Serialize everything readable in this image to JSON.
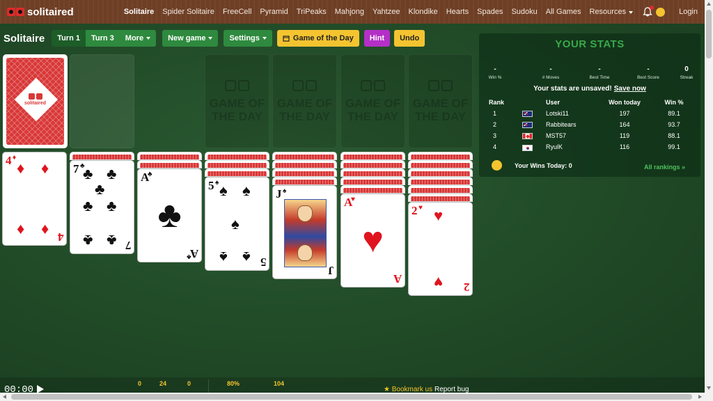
{
  "nav": {
    "logo": "solitaired",
    "links": [
      "Solitaire",
      "Spider Solitaire",
      "FreeCell",
      "Pyramid",
      "TriPeaks",
      "Mahjong",
      "Yahtzee",
      "Klondike",
      "Hearts",
      "Spades",
      "Sudoku",
      "All Games",
      "Resources"
    ],
    "active": "Solitaire",
    "login": "Login"
  },
  "toolbar": {
    "title": "Solitaire",
    "turn1": "Turn 1",
    "turn3": "Turn 3",
    "more": "More",
    "new_game": "New game",
    "settings": "Settings",
    "gotd": "Game of the Day",
    "hint": "Hint",
    "undo": "Undo"
  },
  "foundation_text": "Game of the day",
  "tableau": [
    {
      "rank": "4",
      "suit": "♦",
      "color": "red",
      "hidden": 0
    },
    {
      "rank": "7",
      "suit": "♣",
      "color": "black",
      "hidden": 1
    },
    {
      "rank": "A",
      "suit": "♣",
      "color": "black",
      "hidden": 2
    },
    {
      "rank": "5",
      "suit": "♠",
      "color": "black",
      "hidden": 3
    },
    {
      "rank": "J",
      "suit": "♠",
      "color": "black",
      "hidden": 4
    },
    {
      "rank": "A",
      "suit": "♥",
      "color": "red",
      "hidden": 5
    },
    {
      "rank": "2",
      "suit": "♥",
      "color": "red",
      "hidden": 6
    }
  ],
  "stats": {
    "title": "YOUR STATS",
    "items": [
      {
        "value": "-",
        "label": "Win %"
      },
      {
        "value": "-",
        "label": "# Moves"
      },
      {
        "value": "-",
        "label": "Best Time"
      },
      {
        "value": "-",
        "label": "Best Score"
      },
      {
        "value": "0",
        "label": "Streak"
      }
    ],
    "unsaved": "Your stats are unsaved!",
    "save_now": "Save now",
    "headers": [
      "Rank",
      "User",
      "Won today",
      "Win %"
    ],
    "rows": [
      {
        "rank": "1",
        "flag": "au",
        "user": "Lotski11",
        "won": "197",
        "win": "89.1"
      },
      {
        "rank": "2",
        "flag": "au",
        "user": "Rabbitears",
        "won": "164",
        "win": "93.7"
      },
      {
        "rank": "3",
        "flag": "ca",
        "user": "MST57",
        "won": "119",
        "win": "88.1"
      },
      {
        "rank": "4",
        "flag": "kr",
        "user": "RyulK",
        "won": "116",
        "win": "99.1"
      }
    ],
    "wins_today": "Your Wins Today: 0",
    "all_rankings": "All rankings »"
  },
  "bottom": {
    "timer": "00:00",
    "n1": "0",
    "n2": "24",
    "n3": "0",
    "n4": "80%",
    "n5": "104",
    "bookmark": "★ Bookmark us",
    "report": "Report bug"
  },
  "colors": {
    "felt": "#1f4a26",
    "nav": "#6e3f25",
    "accent_green": "#2e8a3e",
    "accent_yellow": "#f4c430",
    "hint_purple": "#b42fc7",
    "card_red": "#e0141e"
  }
}
